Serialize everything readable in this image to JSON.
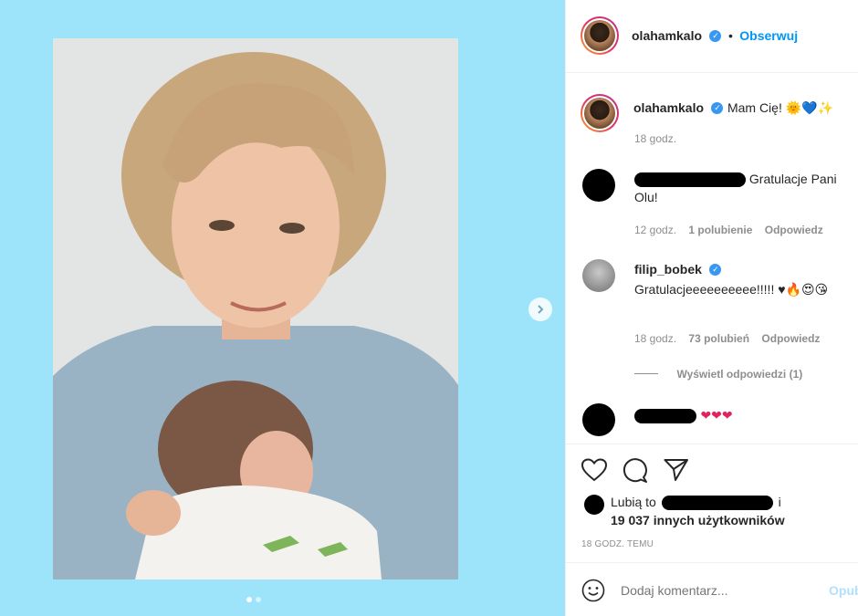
{
  "post": {
    "username": "olahamkalo",
    "follow_label": "Obserwuj",
    "caption": "Mam Cię! 🌞💙✨",
    "caption_time": "18 godz."
  },
  "comments": [
    {
      "text": "Gratulacje Pani Olu!",
      "time": "12 godz.",
      "likes": "1 polubienie",
      "reply": "Odpowiedz"
    },
    {
      "username": "filip_bobek",
      "text": "Gratulacjeeeeeeeeee!!!!! ♥🔥😍😘",
      "time": "18 godz.",
      "likes": "73 polubień",
      "reply": "Odpowiedz",
      "view_replies": "Wyświetl odpowiedzi (1)"
    },
    {
      "text": "❤❤❤"
    }
  ],
  "likes": {
    "prefix": "Lubią to",
    "suffix": "i",
    "count_line": "19 037 innych użytkowników"
  },
  "timestamp": "18 GODZ. TEMU",
  "add_comment": {
    "placeholder": "Dodaj komentarz...",
    "post_label": "Opublikuj"
  },
  "colors": {
    "background": "#9de4fb",
    "link_blue": "#0095f6",
    "verified": "#3897f0"
  }
}
